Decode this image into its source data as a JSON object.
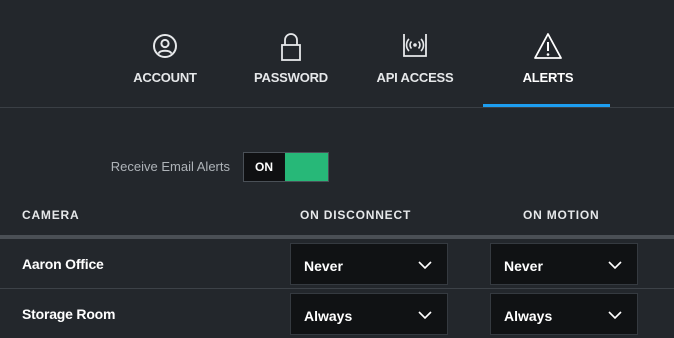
{
  "tabs": [
    {
      "label": "ACCOUNT",
      "icon": "account-icon",
      "active": false
    },
    {
      "label": "PASSWORD",
      "icon": "lock-icon",
      "active": false
    },
    {
      "label": "API ACCESS",
      "icon": "api-signal-icon",
      "active": false
    },
    {
      "label": "ALERTS",
      "icon": "warning-icon",
      "active": true
    }
  ],
  "email_alerts": {
    "label": "Receive Email Alerts",
    "toggle_state": "ON",
    "on_color": "#27b878"
  },
  "table": {
    "headers": {
      "camera": "CAMERA",
      "on_disconnect": "ON DISCONNECT",
      "on_motion": "ON MOTION"
    },
    "rows": [
      {
        "camera": "Aaron Office",
        "on_disconnect": "Never",
        "on_motion": "Never"
      },
      {
        "camera": "Storage Room",
        "on_disconnect": "Always",
        "on_motion": "Always"
      }
    ]
  },
  "colors": {
    "background": "#23272c",
    "active_tab_underline": "#1d9ef0",
    "toggle_on": "#27b878"
  }
}
